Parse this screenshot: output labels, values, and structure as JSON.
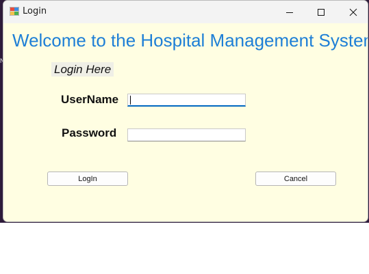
{
  "window": {
    "title": "Login",
    "app_icon": "windows-forms-app-icon",
    "controls": {
      "minimize_icon": "minimize-icon",
      "maximize_icon": "maximize-icon",
      "close_icon": "close-icon"
    }
  },
  "form": {
    "heading": "Welcome to the Hospital Management System",
    "subheading": "Login Here",
    "username": {
      "label": "UserName",
      "value": ""
    },
    "password": {
      "label": "Password",
      "value": ""
    },
    "buttons": {
      "login_label": "LogIn",
      "cancel_label": "Cancel"
    }
  },
  "colors": {
    "form_background": "#fffee2",
    "heading": "#1e7fd6",
    "focus_underline": "#0067c0",
    "titlebar": "#f3f3f3"
  }
}
